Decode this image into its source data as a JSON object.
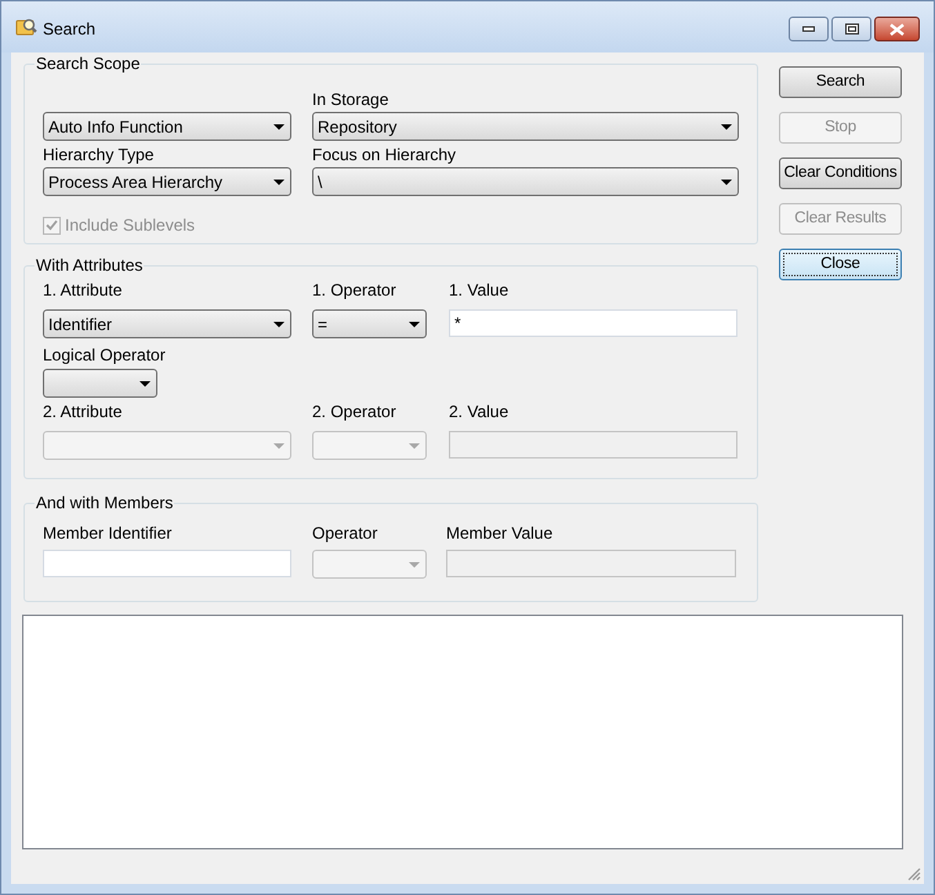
{
  "window": {
    "title": "Search"
  },
  "search_scope": {
    "title": "Search Scope",
    "object_type": {
      "value": "Auto Info Function",
      "disabled": false
    },
    "in_storage": {
      "label": "In Storage",
      "value": "Repository",
      "disabled": false
    },
    "hierarchy_type": {
      "label": "Hierarchy Type",
      "value": "Process Area Hierarchy",
      "disabled": false
    },
    "focus_on_hierarchy": {
      "label": "Focus on Hierarchy",
      "value": "\\",
      "disabled": false
    },
    "include_sublevels": {
      "label": "Include Sublevels",
      "checked": true,
      "disabled": true
    }
  },
  "with_attributes": {
    "title": "With Attributes",
    "rows": [
      {
        "attribute": {
          "label": "1. Attribute",
          "value": "Identifier",
          "disabled": false
        },
        "operator": {
          "label": "1. Operator",
          "value": "=",
          "disabled": false
        },
        "value": {
          "label": "1. Value",
          "value": "*",
          "disabled": false
        }
      },
      {
        "attribute": {
          "label": "2. Attribute",
          "disabled": true
        },
        "operator": {
          "label": "2. Operator",
          "disabled": true
        },
        "value": {
          "label": "2. Value",
          "disabled": true
        }
      }
    ],
    "logical_operator": {
      "label": "Logical Operator",
      "disabled": false
    }
  },
  "and_with_members": {
    "title": "And with Members",
    "member_identifier": {
      "label": "Member Identifier",
      "disabled": false
    },
    "operator": {
      "label": "Operator",
      "disabled": true
    },
    "member_value": {
      "label": "Member Value",
      "disabled": true
    }
  },
  "buttons": [
    {
      "label": "Search",
      "disabled": false,
      "focused": false
    },
    {
      "label": "Stop",
      "disabled": true,
      "focused": false
    },
    {
      "label": "Clear Conditions",
      "disabled": false,
      "focused": false
    },
    {
      "label": "Clear Results",
      "disabled": true,
      "focused": false
    },
    {
      "label": "Close",
      "disabled": false,
      "focused": true
    }
  ]
}
